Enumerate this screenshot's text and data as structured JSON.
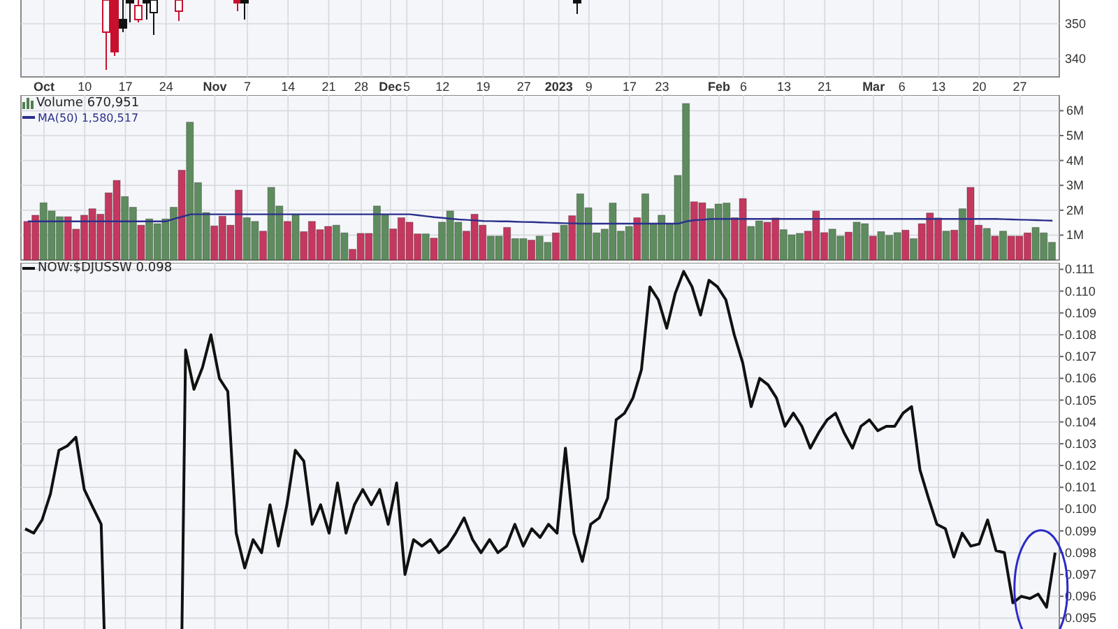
{
  "price_panel": {
    "axis_labels": [
      "350",
      "340"
    ]
  },
  "date_axis": [
    {
      "label": "Oct",
      "kind": "month"
    },
    {
      "label": "10",
      "kind": "day"
    },
    {
      "label": "17",
      "kind": "day"
    },
    {
      "label": "24",
      "kind": "day"
    },
    {
      "label": "Nov",
      "kind": "month"
    },
    {
      "label": "7",
      "kind": "day"
    },
    {
      "label": "14",
      "kind": "day"
    },
    {
      "label": "21",
      "kind": "day"
    },
    {
      "label": "28",
      "kind": "day"
    },
    {
      "label": "Dec",
      "kind": "month"
    },
    {
      "label": "5",
      "kind": "day"
    },
    {
      "label": "12",
      "kind": "day"
    },
    {
      "label": "19",
      "kind": "day"
    },
    {
      "label": "27",
      "kind": "day"
    },
    {
      "label": "2023",
      "kind": "month"
    },
    {
      "label": "9",
      "kind": "day"
    },
    {
      "label": "17",
      "kind": "day"
    },
    {
      "label": "23",
      "kind": "day"
    },
    {
      "label": "Feb",
      "kind": "month"
    },
    {
      "label": "6",
      "kind": "day"
    },
    {
      "label": "13",
      "kind": "day"
    },
    {
      "label": "21",
      "kind": "day"
    },
    {
      "label": "Mar",
      "kind": "month"
    },
    {
      "label": "6",
      "kind": "day"
    },
    {
      "label": "13",
      "kind": "day"
    },
    {
      "label": "20",
      "kind": "day"
    },
    {
      "label": "27",
      "kind": "day"
    }
  ],
  "volume_panel": {
    "legend": [
      {
        "kind": "bars",
        "value": "670,951"
      },
      {
        "kind": "line",
        "value": "1,580,517"
      }
    ],
    "chart_data": {
      "type": "bar",
      "grid": true,
      "ylim": [
        0,
        6.63
      ],
      "yticks": [
        {
          "value": 1,
          "label": "1M"
        },
        {
          "value": 2,
          "label": "2M"
        },
        {
          "value": 3,
          "label": "3M"
        },
        {
          "value": 4,
          "label": "4M"
        },
        {
          "value": 5,
          "label": "5M"
        },
        {
          "value": 6,
          "label": "6M"
        }
      ],
      "series": [
        {
          "name": "Volume",
          "colors": [
            "#c4385f",
            "#c4385f",
            "#5e8c5e",
            "#5e8c5e",
            "#5e8c5e",
            "#c4385f",
            "#c4385f",
            "#c4385f",
            "#c4385f",
            "#c4385f",
            "#c4385f",
            "#c4385f",
            "#5e8c5e",
            "#5e8c5e",
            "#c4385f",
            "#5e8c5e",
            "#5e8c5e",
            "#5e8c5e",
            "#5e8c5e",
            "#c4385f",
            "#5e8c5e",
            "#5e8c5e",
            "#5e8c5e",
            "#c4385f",
            "#c4385f",
            "#c4385f",
            "#c4385f",
            "#5e8c5e",
            "#5e8c5e",
            "#c4385f",
            "#5e8c5e",
            "#5e8c5e",
            "#c4385f",
            "#5e8c5e",
            "#c4385f",
            "#c4385f",
            "#c4385f",
            "#c4385f",
            "#5e8c5e",
            "#5e8c5e",
            "#c4385f",
            "#c4385f",
            "#c4385f",
            "#5e8c5e",
            "#5e8c5e",
            "#c4385f",
            "#c4385f",
            "#c4385f",
            "#c4385f",
            "#5e8c5e",
            "#c4385f",
            "#5e8c5e",
            "#5e8c5e",
            "#5e8c5e",
            "#c4385f",
            "#c4385f",
            "#c4385f",
            "#5e8c5e",
            "#5e8c5e",
            "#c4385f",
            "#5e8c5e",
            "#5e8c5e",
            "#c4385f",
            "#5e8c5e",
            "#5e8c5e",
            "#c4385f",
            "#5e8c5e",
            "#c4385f",
            "#5e8c5e",
            "#5e8c5e",
            "#5e8c5e",
            "#5e8c5e",
            "#5e8c5e",
            "#5e8c5e",
            "#5e8c5e",
            "#c4385f",
            "#5e8c5e",
            "#5e8c5e",
            "#5e8c5e",
            "#5e8c5e",
            "#5e8c5e",
            "#5e8c5e",
            "#c4385f",
            "#c4385f",
            "#5e8c5e",
            "#5e8c5e",
            "#5e8c5e",
            "#c4385f",
            "#c4385f",
            "#5e8c5e",
            "#5e8c5e",
            "#c4385f",
            "#c4385f",
            "#5e8c5e",
            "#5e8c5e",
            "#5e8c5e",
            "#c4385f",
            "#c4385f",
            "#c4385f",
            "#5e8c5e",
            "#5e8c5e",
            "#c4385f",
            "#5e8c5e",
            "#5e8c5e",
            "#c4385f",
            "#5e8c5e",
            "#5e8c5e",
            "#5e8c5e",
            "#c4385f",
            "#5e8c5e",
            "#c4385f",
            "#c4385f",
            "#c4385f",
            "#5e8c5e",
            "#c4385f",
            "#5e8c5e",
            "#c4385f",
            "#c4385f",
            "#5e8c5e",
            "#c4385f",
            "#5e8c5e",
            "#c4385f",
            "#c4385f",
            "#c4385f",
            "#5e8c5e",
            "#5e8c5e",
            "#5e8c5e"
          ],
          "values": [
            1.55,
            1.8,
            2.3,
            1.97,
            1.74,
            1.74,
            1.24,
            1.8,
            2.06,
            1.84,
            2.7,
            3.2,
            2.55,
            2.12,
            1.4,
            1.65,
            1.46,
            1.65,
            2.12,
            3.61,
            5.54,
            3.11,
            1.91,
            1.37,
            1.76,
            1.4,
            2.81,
            1.7,
            1.55,
            1.16,
            2.92,
            2.17,
            1.55,
            1.84,
            1.14,
            1.55,
            1.22,
            1.35,
            1.4,
            1.09,
            0.43,
            1.07,
            1.07,
            2.17,
            1.84,
            1.25,
            1.7,
            1.52,
            1.05,
            1.05,
            0.88,
            1.52,
            1.97,
            1.52,
            1.16,
            1.84,
            1.4,
            0.96,
            0.96,
            1.31,
            0.86,
            0.86,
            0.8,
            0.96,
            0.71,
            1.09,
            1.4,
            1.78,
            2.66,
            2.1,
            1.09,
            1.24,
            2.29,
            1.16,
            1.35,
            1.7,
            2.66,
            1.48,
            1.8,
            1.46,
            3.4,
            6.29,
            2.34,
            2.3,
            2.06,
            2.25,
            2.29,
            1.7,
            2.47,
            1.35,
            1.57,
            1.52,
            1.69,
            1.22,
            1.01,
            1.07,
            1.16,
            1.97,
            1.1,
            1.24,
            0.96,
            1.12,
            1.52,
            1.46,
            0.96,
            1.14,
            0.99,
            1.1,
            1.2,
            0.86,
            1.46,
            1.89,
            1.69,
            1.16,
            1.2,
            2.06,
            2.92,
            1.4,
            1.27,
            0.96,
            1.16,
            0.96,
            0.96,
            1.09,
            1.31,
            1.09,
            0.71
          ]
        },
        {
          "name": "MA(50)",
          "type": "line",
          "color": "#2b2f8c",
          "values": [
            1.55,
            1.55,
            1.55,
            1.55,
            1.55,
            1.55,
            1.55,
            1.55,
            1.55,
            1.55,
            1.55,
            1.55,
            1.55,
            1.55,
            1.55,
            1.55,
            1.55,
            1.55,
            1.65,
            1.74,
            1.84,
            1.84,
            1.84,
            1.84,
            1.84,
            1.84,
            1.84,
            1.84,
            1.84,
            1.84,
            1.84,
            1.84,
            1.84,
            1.84,
            1.84,
            1.84,
            1.84,
            1.84,
            1.84,
            1.84,
            1.84,
            1.84,
            1.84,
            1.84,
            1.84,
            1.84,
            1.84,
            1.84,
            1.8,
            1.76,
            1.72,
            1.69,
            1.66,
            1.63,
            1.61,
            1.59,
            1.57,
            1.56,
            1.55,
            1.55,
            1.54,
            1.53,
            1.52,
            1.51,
            1.5,
            1.49,
            1.48,
            1.47,
            1.46,
            1.46,
            1.46,
            1.46,
            1.46,
            1.46,
            1.46,
            1.46,
            1.46,
            1.46,
            1.46,
            1.46,
            1.46,
            1.55,
            1.6,
            1.62,
            1.65,
            1.65,
            1.65,
            1.65,
            1.65,
            1.65,
            1.65,
            1.65,
            1.65,
            1.65,
            1.65,
            1.65,
            1.65,
            1.65,
            1.65,
            1.65,
            1.65,
            1.65,
            1.65,
            1.65,
            1.65,
            1.65,
            1.65,
            1.65,
            1.65,
            1.65,
            1.65,
            1.65,
            1.65,
            1.65,
            1.65,
            1.65,
            1.65,
            1.65,
            1.65,
            1.65,
            1.64,
            1.63,
            1.62,
            1.61,
            1.6,
            1.59,
            1.58
          ]
        }
      ]
    }
  },
  "ratio_panel": {
    "reading": "0.098",
    "highlight": {
      "color": "#2a2ac8"
    },
    "chart_data": {
      "type": "line",
      "grid": true,
      "ylim": [
        0.0945,
        0.1113
      ],
      "yticks": [
        {
          "value": 0.111,
          "label": "0.111"
        },
        {
          "value": 0.11,
          "label": "0.110"
        },
        {
          "value": 0.109,
          "label": "0.109"
        },
        {
          "value": 0.108,
          "label": "0.108"
        },
        {
          "value": 0.107,
          "label": "0.107"
        },
        {
          "value": 0.106,
          "label": "0.106"
        },
        {
          "value": 0.105,
          "label": "0.105"
        },
        {
          "value": 0.104,
          "label": "0.104"
        },
        {
          "value": 0.103,
          "label": "0.103"
        },
        {
          "value": 0.102,
          "label": "0.102"
        },
        {
          "value": 0.101,
          "label": "0.101"
        },
        {
          "value": 0.1,
          "label": "0.100"
        },
        {
          "value": 0.099,
          "label": "0.099"
        },
        {
          "value": 0.098,
          "label": "0.098"
        },
        {
          "value": 0.097,
          "label": "0.097"
        },
        {
          "value": 0.096,
          "label": "0.096"
        },
        {
          "value": 0.095,
          "label": "0.095"
        }
      ],
      "series": [
        {
          "name": "NOW:$DJUSSW",
          "color": "#111111",
          "values": [
            0.0991,
            0.0989,
            0.0995,
            0.1007,
            0.1027,
            0.1029,
            0.1033,
            0.1009,
            0.1001,
            0.0993,
            null,
            null,
            null,
            null,
            null,
            null,
            null,
            null,
            null,
            0.1073,
            0.1055,
            0.1065,
            0.108,
            0.106,
            0.1054,
            0.0989,
            0.0973,
            0.0986,
            0.098,
            0.1002,
            0.0983,
            0.1002,
            0.1027,
            0.1022,
            0.0993,
            0.1002,
            0.0989,
            0.1012,
            0.0989,
            0.1002,
            0.1009,
            0.1002,
            0.1009,
            0.0993,
            0.1012,
            0.097,
            0.0986,
            0.0983,
            0.0986,
            0.098,
            0.0983,
            0.0989,
            0.0996,
            0.0986,
            0.098,
            0.0986,
            0.098,
            0.0983,
            0.0993,
            0.0983,
            0.0991,
            0.0987,
            0.0993,
            0.0989,
            0.1028,
            0.0989,
            0.0976,
            0.0993,
            0.0996,
            0.1005,
            0.1041,
            0.1044,
            0.1051,
            0.1064,
            0.1102,
            0.1096,
            0.1083,
            0.1099,
            0.1109,
            0.1102,
            0.1089,
            0.1105,
            0.1102,
            0.1096,
            0.108,
            0.1067,
            0.1047,
            0.106,
            0.1057,
            0.1051,
            0.1038,
            0.1044,
            0.1038,
            0.1028,
            0.1035,
            0.1041,
            0.1044,
            0.1035,
            0.1028,
            0.1038,
            0.1041,
            0.1036,
            0.1038,
            0.1038,
            0.1044,
            0.1047,
            0.1018,
            0.1005,
            0.0993,
            0.0991,
            0.0978,
            0.0989,
            0.0983,
            0.0984,
            0.0995,
            0.0981,
            0.098,
            0.0957,
            0.096,
            0.0959,
            0.0961,
            0.0955,
            0.098
          ]
        }
      ]
    }
  }
}
